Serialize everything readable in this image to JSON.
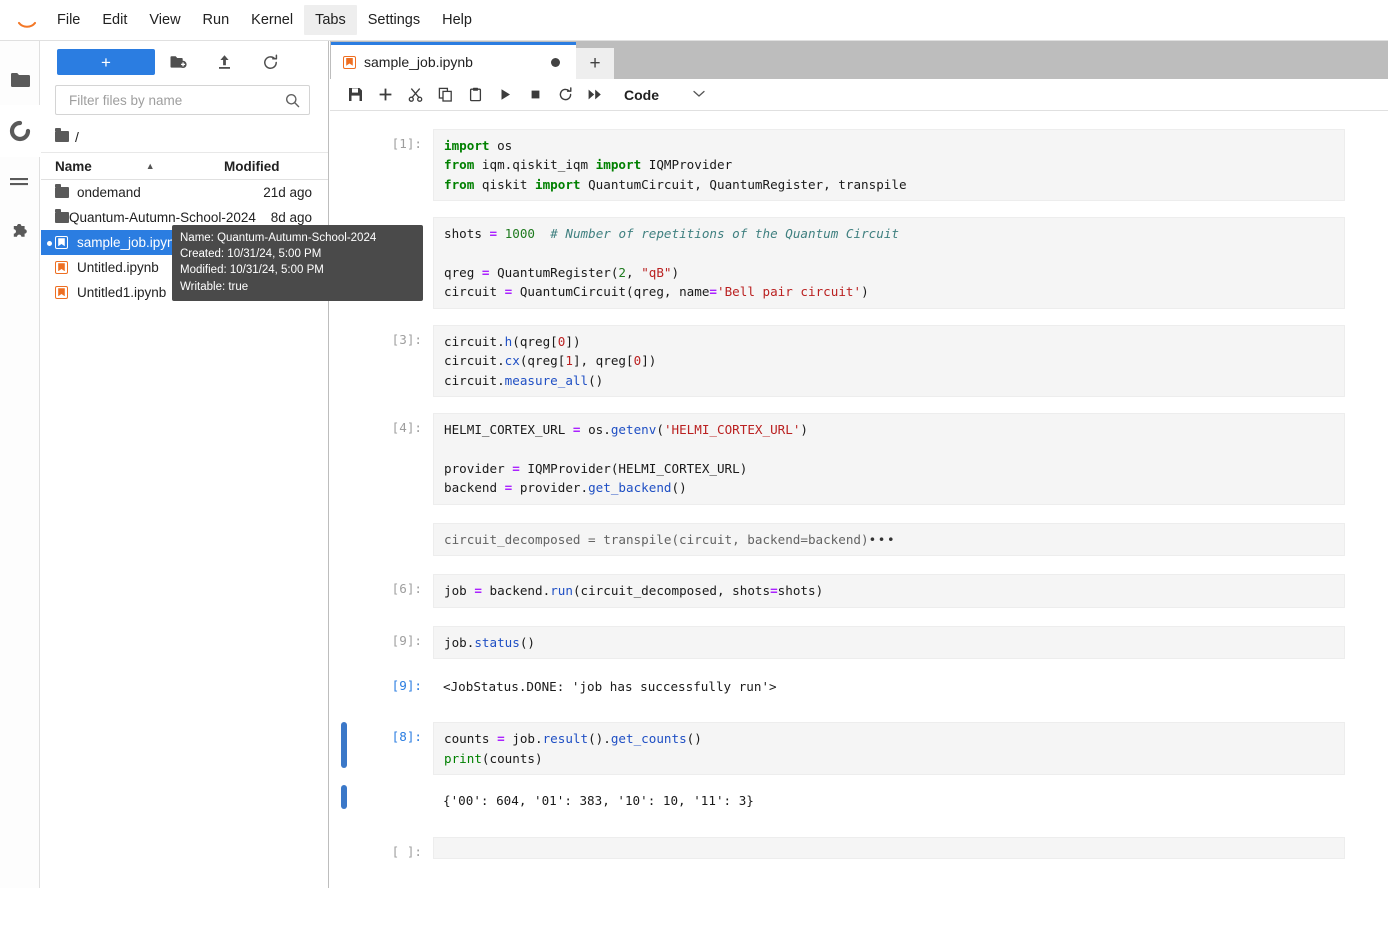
{
  "app": {
    "name": "JupyterLab",
    "logo_icon": "jupyter-logo-icon"
  },
  "menubar": {
    "items": [
      {
        "label": "File",
        "active": false
      },
      {
        "label": "Edit",
        "active": false
      },
      {
        "label": "View",
        "active": false
      },
      {
        "label": "Run",
        "active": false
      },
      {
        "label": "Kernel",
        "active": false
      },
      {
        "label": "Tabs",
        "active": true
      },
      {
        "label": "Settings",
        "active": false
      },
      {
        "label": "Help",
        "active": false
      }
    ]
  },
  "activitybar": {
    "items": [
      {
        "icon": "folder-icon",
        "name": "file-browser",
        "selected": false
      },
      {
        "icon": "running-icon",
        "name": "running-terminals",
        "selected": true
      },
      {
        "icon": "commands-icon",
        "name": "command-palette",
        "selected": false
      },
      {
        "icon": "puzzle-icon",
        "name": "extension-manager",
        "selected": false
      }
    ]
  },
  "filebrowser": {
    "toolbar": {
      "new_launcher_label": "+",
      "new_folder_icon": "new-folder-icon",
      "upload_icon": "upload-icon",
      "refresh_icon": "refresh-icon"
    },
    "filter": {
      "placeholder": "Filter files by name",
      "value": "",
      "icon": "search-icon"
    },
    "breadcrumb": {
      "icon": "folder-icon",
      "path": "/"
    },
    "columns": {
      "name": "Name",
      "modified": "Modified",
      "sort_caret": "▲"
    },
    "rows": [
      {
        "name": "ondemand",
        "modified": "21d ago",
        "icon": "folder-icon",
        "selected": false,
        "dirty": false
      },
      {
        "name": "Quantum-Autumn-School-2024",
        "modified": "8d ago",
        "icon": "folder-icon",
        "selected": false,
        "dirty": false
      },
      {
        "name": "sample_job.ipynb",
        "modified": "",
        "icon": "notebook-icon",
        "selected": true,
        "dirty": true
      },
      {
        "name": "Untitled.ipynb",
        "modified": "8d ago",
        "icon": "notebook-icon",
        "selected": false,
        "dirty": false
      },
      {
        "name": "Untitled1.ipynb",
        "modified": "8d ago",
        "icon": "notebook-icon",
        "selected": false,
        "dirty": false
      }
    ]
  },
  "tooltip": {
    "lines": [
      "Name: Quantum-Autumn-School-2024",
      "Created: 10/31/24, 5:00 PM",
      "Modified: 10/31/24, 5:00 PM",
      "Writable: true"
    ]
  },
  "notebook": {
    "tab": {
      "label": "sample_job.ipynb",
      "icon": "notebook-icon",
      "dirty_indicator": "●",
      "add_tab_label": "+"
    },
    "toolbar": {
      "buttons": [
        {
          "icon": "save-icon",
          "name": "save-button"
        },
        {
          "icon": "insert-cell-icon",
          "name": "insert-cell-button"
        },
        {
          "icon": "cut-icon",
          "name": "cut-button"
        },
        {
          "icon": "copy-icon",
          "name": "copy-button"
        },
        {
          "icon": "paste-icon",
          "name": "paste-button"
        },
        {
          "icon": "run-icon",
          "name": "run-button"
        },
        {
          "icon": "stop-icon",
          "name": "stop-button"
        },
        {
          "icon": "restart-icon",
          "name": "restart-button"
        },
        {
          "icon": "restart-run-all-icon",
          "name": "restart-run-all-button"
        }
      ],
      "celltype_value": "Code",
      "celltype_caret": "⌄"
    },
    "cells": [
      {
        "prompt": "[1]:",
        "kind": "code",
        "selected": false,
        "collapsed": false
      },
      {
        "prompt": "",
        "kind": "code",
        "selected": false,
        "collapsed": false
      },
      {
        "prompt": "[3]:",
        "kind": "code",
        "selected": false,
        "collapsed": false
      },
      {
        "prompt": "[4]:",
        "kind": "code",
        "selected": false,
        "collapsed": false
      },
      {
        "prompt": "",
        "kind": "code",
        "selected": false,
        "collapsed": true
      },
      {
        "prompt": "[6]:",
        "kind": "code",
        "selected": false,
        "collapsed": false
      },
      {
        "prompt": "[9]:",
        "kind": "code",
        "selected": false,
        "collapsed": false
      },
      {
        "prompt": "[9]:",
        "kind": "output",
        "selected": false,
        "collapsed": false
      },
      {
        "prompt": "[8]:",
        "kind": "code",
        "selected": true,
        "collapsed": false
      },
      {
        "prompt": "",
        "kind": "output",
        "selected": true,
        "collapsed": false
      },
      {
        "prompt": "[ ]:",
        "kind": "code",
        "selected": false,
        "collapsed": false
      }
    ],
    "source": {
      "cell1_line1": "import os",
      "cell1_line2": "from iqm.qiskit_iqm import IQMProvider",
      "cell1_line3": "from qiskit import QuantumCircuit, QuantumRegister, transpile",
      "cell2_line1": "shots = 1000  # Number of repetitions of the Quantum Circuit",
      "cell2_line3": "qreg = QuantumRegister(2, \"qB\")",
      "cell2_line4": "circuit = QuantumCircuit(qreg, name='Bell pair circuit')",
      "cell3_line1": "circuit.h(qreg[0])",
      "cell3_line2": "circuit.cx(qreg[1], qreg[0])",
      "cell3_line3": "circuit.measure_all()",
      "cell4_line1": "HELMI_CORTEX_URL = os.getenv('HELMI_CORTEX_URL')",
      "cell4_line3": "provider = IQMProvider(HELMI_CORTEX_URL)",
      "cell4_line4": "backend = provider.get_backend()",
      "cell5_collapsed": "circuit_decomposed = transpile(circuit, backend=backend)",
      "cell5_ellipsis": "•••",
      "cell6_line1": "job = backend.run(circuit_decomposed, shots=shots)",
      "cell7_line1": "job.status()",
      "cell7_output": "<JobStatus.DONE: 'job has successfully run'>",
      "cell8_line1": "counts = job.result().get_counts()",
      "cell8_line2": "print(counts)",
      "cell8_output": "{'00': 604, '01': 383, '10': 10, '11': 3}",
      "cell9_empty": ""
    }
  },
  "colors": {
    "accent": "#2b7de1",
    "selection_bar": "#3b78c8",
    "notebook_icon": "#ee6f22",
    "tabbar_bg": "#bdbdbd",
    "cell_input_bg": "#f5f5f5",
    "tooltip_bg": "#4a4a4a"
  }
}
